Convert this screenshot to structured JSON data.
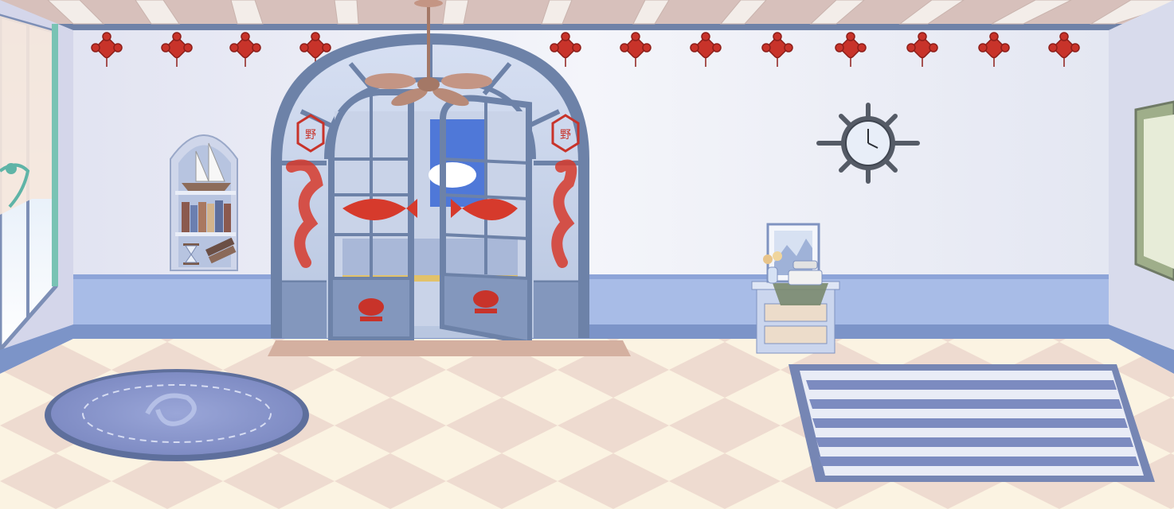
{
  "scene": {
    "description_name": "room-background",
    "knot_count": 14,
    "door_glass_chars": [
      "野",
      "野"
    ],
    "palette": {
      "ceiling": "#d9c2bc",
      "beam": "#f1ebe8",
      "wall": "#eceef6",
      "wainscot": "#a9bde6",
      "baseboard": "#7a93c7",
      "floor_light": "#fbf1dc",
      "floor_dark": "#e6cdbf",
      "door_frame": "#6f84a8",
      "knot_red": "#c8332a",
      "rug_blue": "#8c9ad0",
      "fan": "#c49584"
    }
  }
}
